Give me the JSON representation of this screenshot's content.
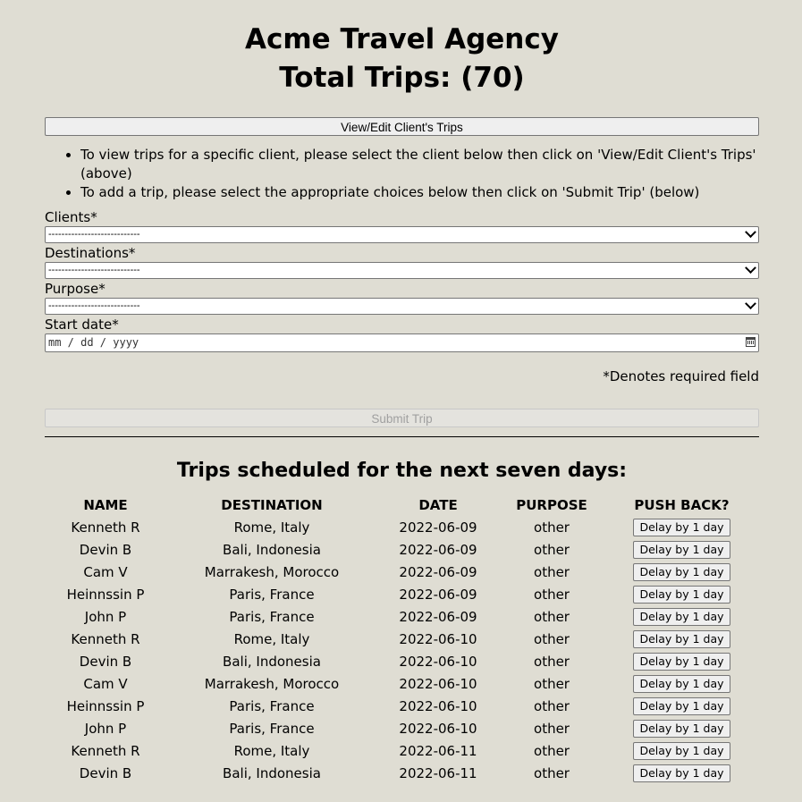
{
  "header": {
    "title": "Acme Travel Agency",
    "total_trips": "Total Trips: (70)"
  },
  "view_button_label": "View/Edit Client's Trips",
  "instructions": [
    "To view trips for a specific client, please select the client below then click on 'View/Edit Client's Trips' (above)",
    "To add a trip, please select the appropriate choices below then click on 'Submit Trip' (below)"
  ],
  "form": {
    "clients_label": "Clients*",
    "clients_value": "----------------------------",
    "destinations_label": "Destinations*",
    "destinations_value": "----------------------------",
    "purpose_label": "Purpose*",
    "purpose_value": "----------------------------",
    "start_date_label": "Start date*",
    "start_date_placeholder": "mm / dd / yyyy",
    "required_note": "*Denotes required field",
    "submit_label": "Submit Trip"
  },
  "schedule": {
    "heading": "Trips scheduled for the next seven days:",
    "columns": [
      "NAME",
      "DESTINATION",
      "DATE",
      "PURPOSE",
      "PUSH BACK?"
    ],
    "button_label": "Delay by 1 day",
    "rows": [
      {
        "name": "Kenneth R",
        "destination": "Rome, Italy",
        "date": "2022-06-09",
        "purpose": "other"
      },
      {
        "name": "Devin B",
        "destination": "Bali, Indonesia",
        "date": "2022-06-09",
        "purpose": "other"
      },
      {
        "name": "Cam V",
        "destination": "Marrakesh, Morocco",
        "date": "2022-06-09",
        "purpose": "other"
      },
      {
        "name": "Heinnssin P",
        "destination": "Paris, France",
        "date": "2022-06-09",
        "purpose": "other"
      },
      {
        "name": "John P",
        "destination": "Paris, France",
        "date": "2022-06-09",
        "purpose": "other"
      },
      {
        "name": "Kenneth R",
        "destination": "Rome, Italy",
        "date": "2022-06-10",
        "purpose": "other"
      },
      {
        "name": "Devin B",
        "destination": "Bali, Indonesia",
        "date": "2022-06-10",
        "purpose": "other"
      },
      {
        "name": "Cam V",
        "destination": "Marrakesh, Morocco",
        "date": "2022-06-10",
        "purpose": "other"
      },
      {
        "name": "Heinnssin P",
        "destination": "Paris, France",
        "date": "2022-06-10",
        "purpose": "other"
      },
      {
        "name": "John P",
        "destination": "Paris, France",
        "date": "2022-06-10",
        "purpose": "other"
      },
      {
        "name": "Kenneth R",
        "destination": "Rome, Italy",
        "date": "2022-06-11",
        "purpose": "other"
      },
      {
        "name": "Devin B",
        "destination": "Bali, Indonesia",
        "date": "2022-06-11",
        "purpose": "other"
      }
    ]
  }
}
